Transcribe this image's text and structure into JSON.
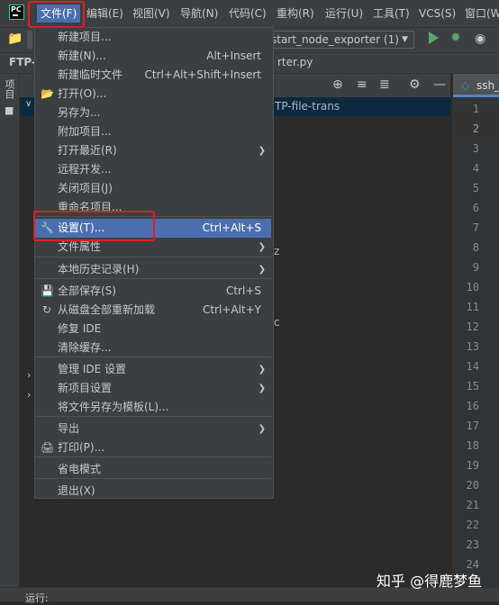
{
  "app": {
    "logo_text": "PC"
  },
  "menubar": {
    "items": [
      "文件(F)",
      "编辑(E)",
      "视图(V)",
      "导航(N)",
      "代码(C)",
      "重构(R)",
      "运行(U)",
      "工具(T)",
      "VCS(S)",
      "窗口(W"
    ]
  },
  "toolbar": {
    "run_config": "start_node_exporter (1)"
  },
  "tabs": {
    "project_tab": "FTP-",
    "file_tab": "rter.py"
  },
  "left_strip": {
    "project_label": "项目"
  },
  "project_tree": {
    "selected_text": "TP-file-trans",
    "ghost1": "z",
    "ghost2": "c"
  },
  "editor": {
    "tab_label": "ssh_",
    "line_numbers": [
      "1",
      "2",
      "3",
      "4",
      "5",
      "6",
      "7",
      "8",
      "9",
      "10",
      "11",
      "12",
      "13",
      "14",
      "15",
      "16",
      "17",
      "18",
      "19",
      "20",
      "21",
      "22",
      "23",
      "24"
    ]
  },
  "file_menu": {
    "items": [
      {
        "label": "新建项目...",
        "shortcut": ""
      },
      {
        "label": "新建(N)...",
        "shortcut": "Alt+Insert"
      },
      {
        "label": "新建临时文件",
        "shortcut": "Ctrl+Alt+Shift+Insert"
      },
      {
        "label": "打开(O)...",
        "shortcut": ""
      },
      {
        "label": "另存为...",
        "shortcut": ""
      },
      {
        "label": "附加项目...",
        "shortcut": ""
      },
      {
        "label": "打开最近(R)",
        "shortcut": ""
      },
      {
        "label": "远程开发...",
        "shortcut": ""
      },
      {
        "label": "关闭项目(J)",
        "shortcut": ""
      },
      {
        "label": "重命名项目...",
        "shortcut": ""
      },
      {
        "label": "设置(T)...",
        "shortcut": "Ctrl+Alt+S"
      },
      {
        "label": "文件属性",
        "shortcut": ""
      },
      {
        "label": "本地历史记录(H)",
        "shortcut": ""
      },
      {
        "label": "全部保存(S)",
        "shortcut": "Ctrl+S"
      },
      {
        "label": "从磁盘全部重新加载",
        "shortcut": "Ctrl+Alt+Y"
      },
      {
        "label": "修复 IDE",
        "shortcut": ""
      },
      {
        "label": "清除缓存...",
        "shortcut": ""
      },
      {
        "label": "管理 IDE 设置",
        "shortcut": ""
      },
      {
        "label": "新项目设置",
        "shortcut": ""
      },
      {
        "label": "将文件另存为模板(L)...",
        "shortcut": ""
      },
      {
        "label": "导出",
        "shortcut": ""
      },
      {
        "label": "打印(P)...",
        "shortcut": ""
      },
      {
        "label": "省电模式",
        "shortcut": ""
      },
      {
        "label": "退出(X)",
        "shortcut": ""
      }
    ]
  },
  "bottom_bar": {
    "label": "运行:"
  },
  "watermark": "知乎 @得鹿梦鱼",
  "colors": {
    "selection": "#4b6eaf",
    "highlight_box": "#e02020",
    "run_green": "#59a869"
  }
}
